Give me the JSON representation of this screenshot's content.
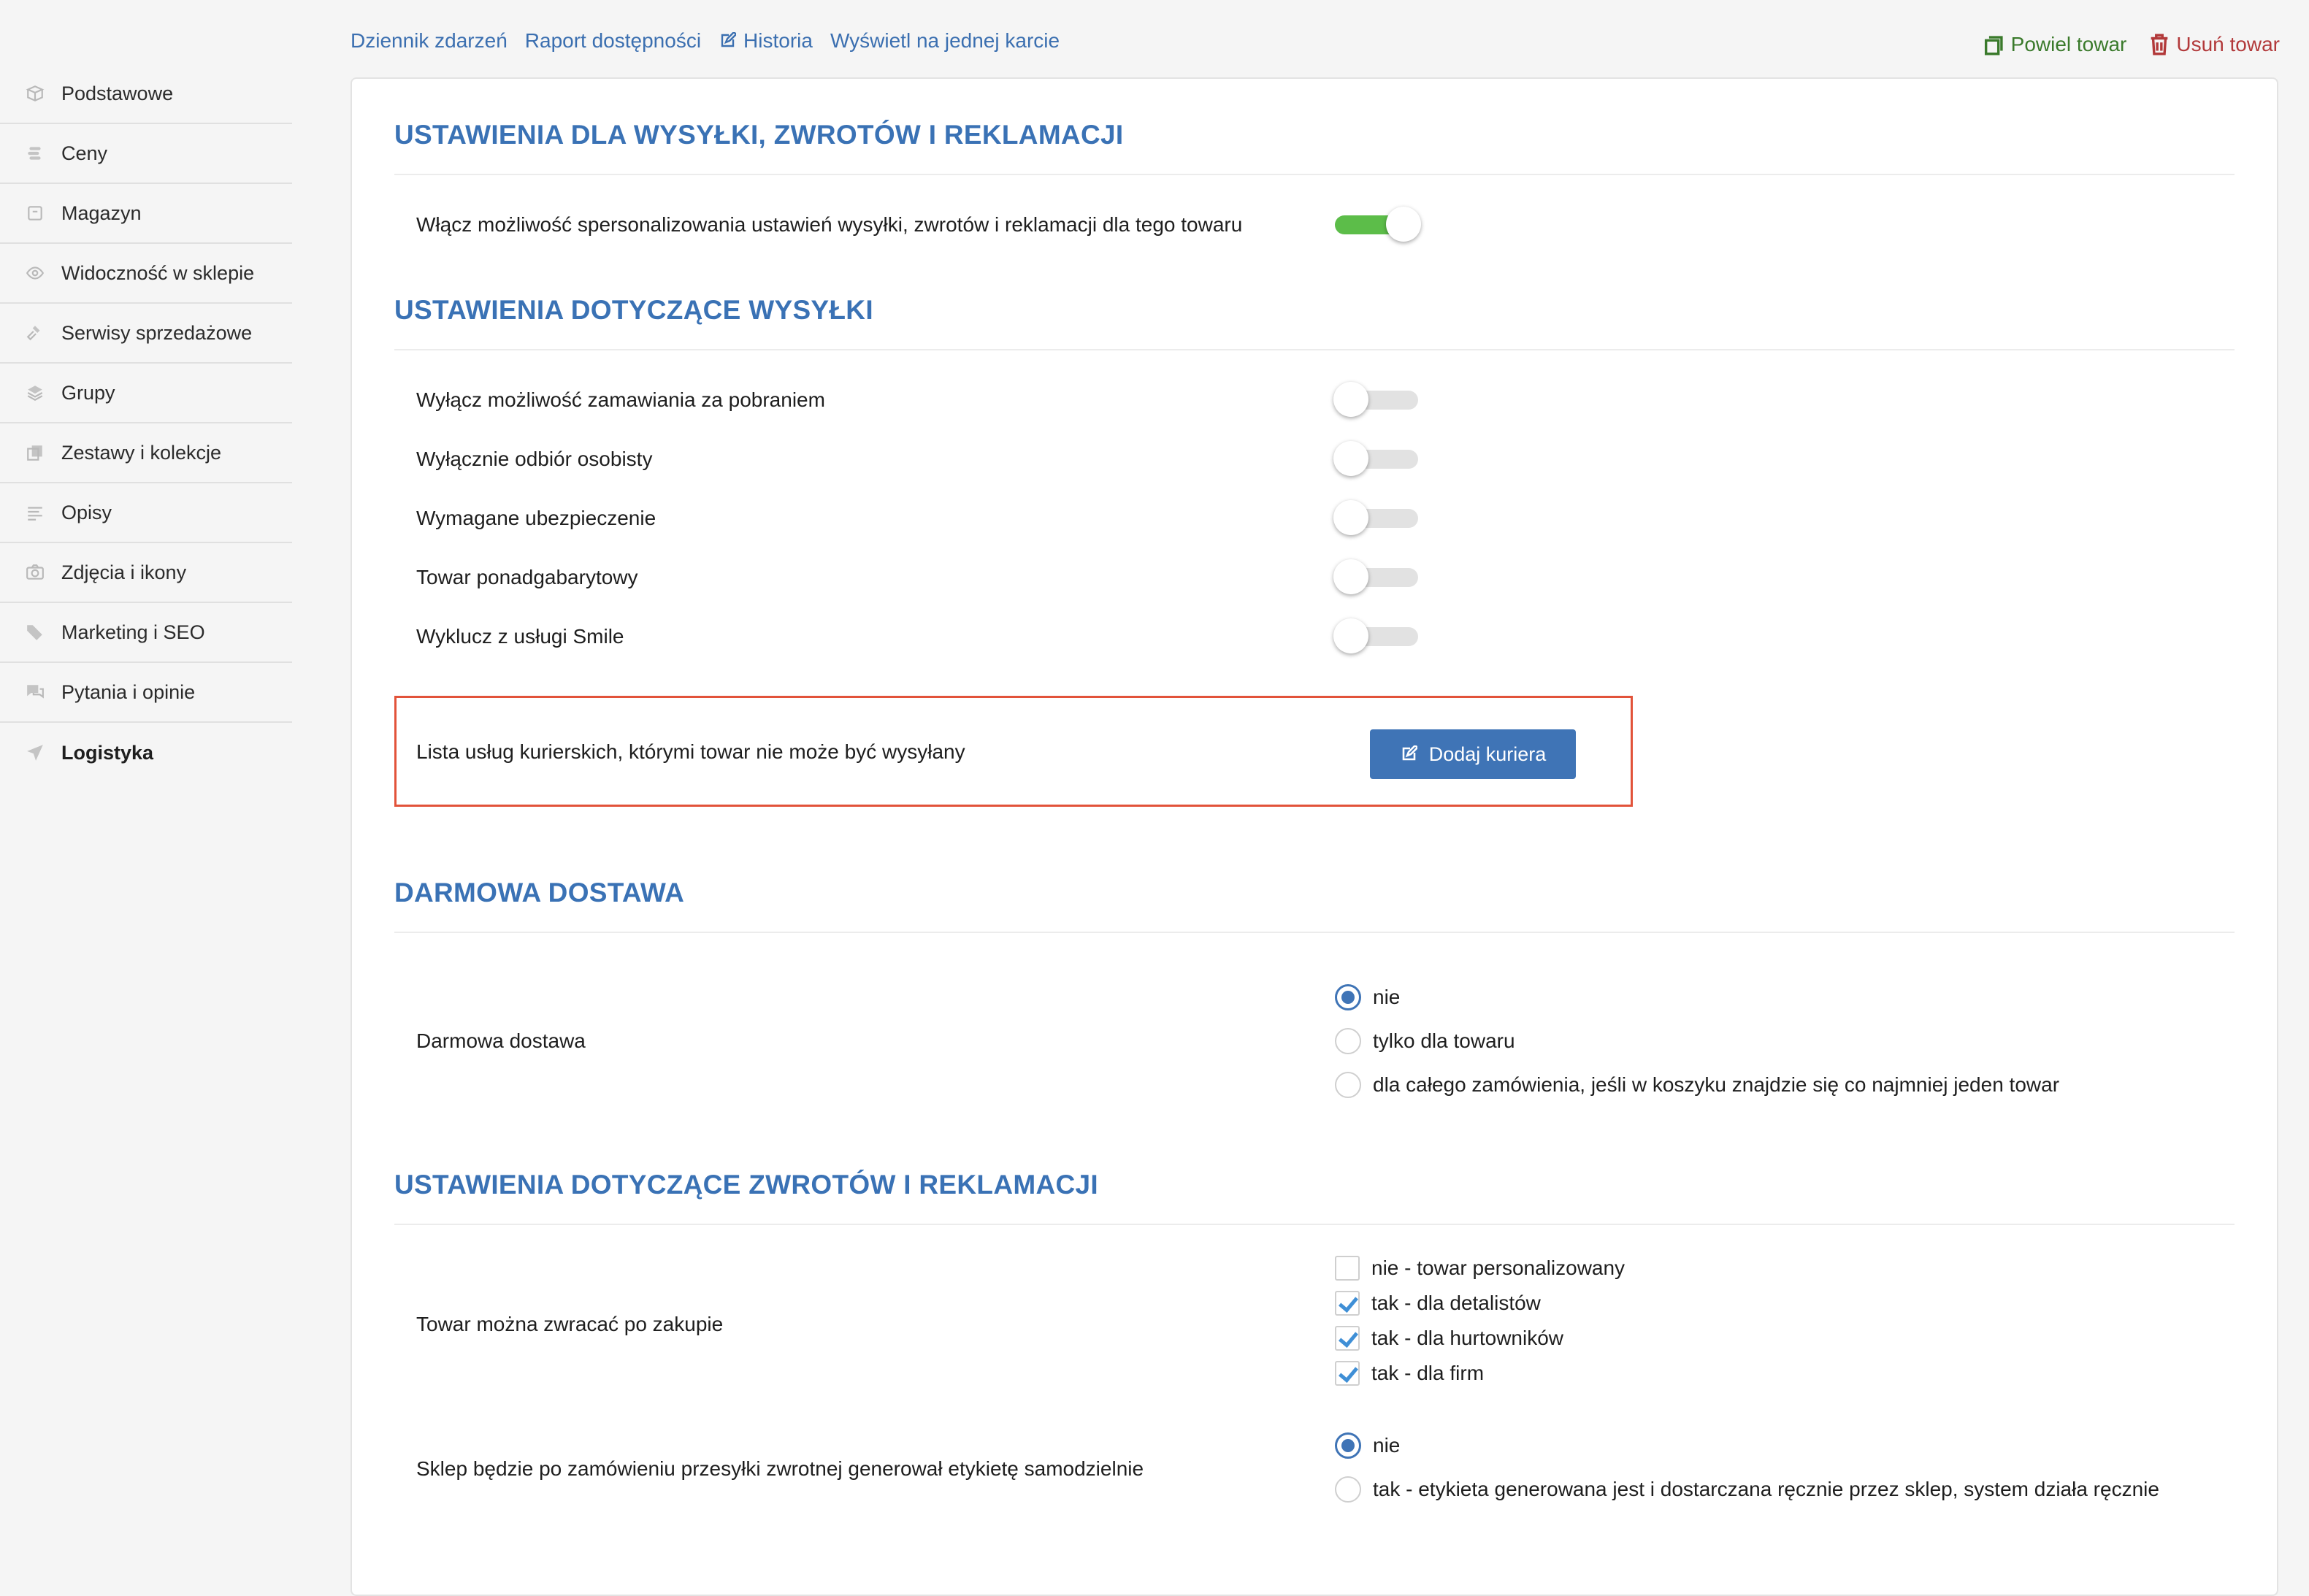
{
  "sidebar": {
    "items": [
      {
        "label": "Podstawowe",
        "icon": "box-icon"
      },
      {
        "label": "Ceny",
        "icon": "coins-icon"
      },
      {
        "label": "Magazyn",
        "icon": "archive-icon"
      },
      {
        "label": "Widoczność w sklepie",
        "icon": "eye-icon"
      },
      {
        "label": "Serwisy sprzedażowe",
        "icon": "gavel-icon"
      },
      {
        "label": "Grupy",
        "icon": "layers-icon"
      },
      {
        "label": "Zestawy i kolekcje",
        "icon": "copy-icon"
      },
      {
        "label": "Opisy",
        "icon": "text-icon"
      },
      {
        "label": "Zdjęcia i ikony",
        "icon": "camera-icon"
      },
      {
        "label": "Marketing i SEO",
        "icon": "tags-icon"
      },
      {
        "label": "Pytania i opinie",
        "icon": "comments-icon"
      },
      {
        "label": "Logistyka",
        "icon": "send-icon",
        "active": true
      }
    ]
  },
  "toplinks": {
    "event_log": "Dziennik zdarzeń",
    "availability_report": "Raport dostępności",
    "history": "Historia",
    "single_card": "Wyświetl na jednej karcie"
  },
  "actions": {
    "duplicate": "Powiel towar",
    "delete": "Usuń towar",
    "duplicate_color": "#3a7a2b",
    "delete_color": "#b2393a"
  },
  "section1": {
    "title": "USTAWIENIA DLA WYSYŁKI, ZWROTÓW I REKLAMACJI",
    "personalize_label": "Włącz możliwość spersonalizowania ustawień wysyłki, zwrotów i reklamacji dla tego towaru",
    "personalize_on": true
  },
  "section2": {
    "title": "USTAWIENIA DOTYCZĄCE WYSYŁKI",
    "toggles": [
      {
        "label": "Wyłącz możliwość zamawiania za pobraniem",
        "on": false
      },
      {
        "label": "Wyłącznie odbiór osobisty",
        "on": false
      },
      {
        "label": "Wymagane ubezpieczenie",
        "on": false
      },
      {
        "label": "Towar ponadgabarytowy",
        "on": false
      },
      {
        "label": "Wyklucz z usługi Smile",
        "on": false
      }
    ],
    "couriers_label": "Lista usług kurierskich, którymi towar nie może być wysyłany",
    "add_courier_button": "Dodaj kuriera"
  },
  "section3": {
    "title": "DARMOWA DOSTAWA",
    "label": "Darmowa dostawa",
    "options": [
      "nie",
      "tylko dla towaru",
      "dla całego zamówienia, jeśli w koszyku znajdzie się co najmniej jeden towar"
    ],
    "selected": 0
  },
  "section4": {
    "title": "USTAWIENIA DOTYCZĄCE ZWROTÓW I REKLAMACJI",
    "returns_label": "Towar można zwracać po zakupie",
    "returns_options": [
      {
        "label": "nie - towar personalizowany",
        "checked": false
      },
      {
        "label": "tak - dla detalistów",
        "checked": true
      },
      {
        "label": "tak - dla hurtowników",
        "checked": true
      },
      {
        "label": "tak - dla firm",
        "checked": true
      }
    ],
    "label_gen_label": "Sklep będzie po zamówieniu przesyłki zwrotnej generował etykietę samodzielnie",
    "label_gen_options": [
      "nie",
      "tak - etykieta generowana jest i dostarczana ręcznie przez sklep, system działa ręcznie"
    ],
    "label_gen_selected": 0
  },
  "colors": {
    "accent": "#3a72b5",
    "toggle_on": "#5cbd49",
    "highlight_border": "#e2533a"
  }
}
